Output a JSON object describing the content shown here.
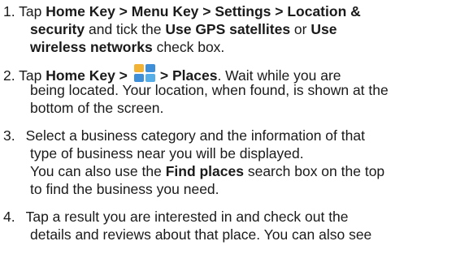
{
  "steps": [
    {
      "num": "1.",
      "l1": {
        "pre": " Tap ",
        "b1": "Home Key > Menu Key > Settings > Location &"
      },
      "l2": {
        "b1": "security",
        "t1": " and tick the ",
        "b2": "Use GPS satellites",
        "t2": " or ",
        "b3": "Use"
      },
      "l3": {
        "b1": "wireless networks",
        "t1": " check box."
      }
    },
    {
      "num": "2.",
      "l1": {
        "pre": " Tap ",
        "b1": "Home Key >",
        "icon": "app-drawer-icon",
        "b2": "> Places",
        "t1": ". Wait while you are"
      },
      "l2": "being located. Your location, when found, is shown at the",
      "l3": "bottom of the screen."
    },
    {
      "num": "3.",
      "l1": "Select a business category and the information of that",
      "l2": "type of business near you will be displayed.",
      "l3": {
        "t1": "You can also use the ",
        "b1": "Find places",
        "t2": " search box on the top"
      },
      "l4": "to find the business you need."
    },
    {
      "num": "4.",
      "l1": "Tap a result you are interested in and check out the",
      "l2": "details and reviews about that place. You can also see"
    }
  ]
}
